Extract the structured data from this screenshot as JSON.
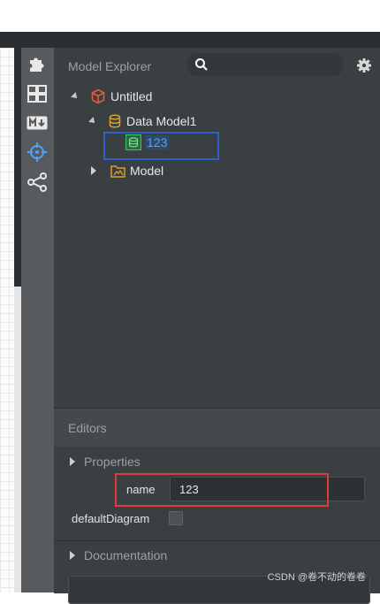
{
  "explorer": {
    "title": "Model Explorer",
    "search_placeholder": "",
    "tree": {
      "root": "Untitled",
      "data_model": "Data Model1",
      "selected_item": "123",
      "model": "Model"
    }
  },
  "editors": {
    "title": "Editors",
    "properties_label": "Properties",
    "name_label": "name",
    "name_value": "123",
    "default_diagram_label": "defaultDiagram",
    "documentation_label": "Documentation"
  },
  "watermark": "CSDN @卷不动的卷卷",
  "colors": {
    "panel_bg": "#3a3f42",
    "activity_bg": "#575b5e",
    "selection_highlight": "#2f5fc9",
    "name_highlight": "#e0393e",
    "link_blue": "#4da3ff",
    "data_icon_green": "#39c46a",
    "model_icon_yellow": "#d6a22a",
    "root_icon_red": "#e8583f"
  },
  "icons": [
    "extensions-icon",
    "layout-icon",
    "markdown-icon",
    "crosshair-icon",
    "share-icon",
    "search-icon",
    "gear-icon",
    "cube-icon",
    "database-icon",
    "table-icon",
    "diagram-icon"
  ]
}
